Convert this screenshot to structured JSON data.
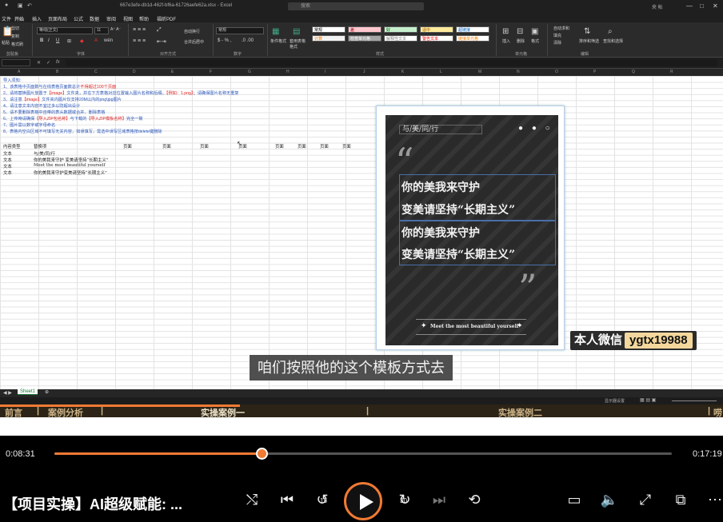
{
  "excel": {
    "filename": "667e3efe-db1d-462f-bf6a-61726aefe62a.xlsx  -  Excel",
    "search_placeholder": "搜索",
    "user": "夹 帐",
    "tabs": [
      "文件",
      "开始",
      "插入",
      "页面布局",
      "公式",
      "数据",
      "审阅",
      "视图",
      "帮助",
      "福昕PDF"
    ],
    "active_tab": "开始",
    "ribbon": {
      "clipboard_items": [
        "剪切",
        "复制",
        "格式刷"
      ],
      "paste": "粘贴",
      "font_name": "等线(正文)",
      "font_size": "11",
      "wrap": "自动换行",
      "merge": "合并后居中",
      "number_format": "常规",
      "conditional_format": "条件格式",
      "table_format": "套用表格格式",
      "styles": [
        {
          "label": "常规",
          "bg": "#ffffff",
          "fg": "#000000"
        },
        {
          "label": "差",
          "bg": "#ffc7ce",
          "fg": "#9c0006"
        },
        {
          "label": "好",
          "bg": "#c6efce",
          "fg": "#006100"
        },
        {
          "label": "适中",
          "bg": "#ffeb9c",
          "fg": "#9c5700"
        },
        {
          "label": "超链接",
          "bg": "#ffffff",
          "fg": "#0563c1"
        },
        {
          "label": "计算",
          "bg": "#f2f2f2",
          "fg": "#fa7d00"
        },
        {
          "label": "检查单元格",
          "bg": "#a5a5a5",
          "fg": "#ffffff"
        },
        {
          "label": "解释性文本",
          "bg": "#ffffff",
          "fg": "#7f7f7f"
        },
        {
          "label": "警告文本",
          "bg": "#ffffff",
          "fg": "#ff0000"
        },
        {
          "label": "链接单元格",
          "bg": "#ffffff",
          "fg": "#fa7d00"
        }
      ],
      "cells_items": [
        "插入",
        "删除",
        "格式"
      ],
      "editing_items": [
        "自动求和",
        "填充",
        "清除",
        "排序和筛选",
        "查找和选择"
      ],
      "groups": [
        "剪贴板",
        "字体",
        "对齐方式",
        "数字",
        "样式",
        "单元格",
        "编辑"
      ]
    },
    "name_box": "",
    "fx_label": "fx",
    "columns": [
      "A",
      "B",
      "C",
      "D",
      "E",
      "F",
      "G",
      "H",
      "I",
      "J",
      "K",
      "L",
      "M",
      "N",
      "O",
      "P",
      "Q",
      "R"
    ],
    "instructions_title": "导入须知:",
    "instructions": [
      "1、该表格中页面数与在线表格页面数总计不得超过100个页面",
      "2、请将替换图片放置于【image】文件夹，并在下方表格对应位置输入图片名称和后缀。【例如：1.png】；请确保图片名称无重复",
      "3、请注意【image】文件夹内图片仅支持20M以内的png\\jpg图片",
      "4、请注意文本内容不宜过多以防超出设计",
      "5、请不要删除表格中自带的表头数据或合并、删除表格",
      "6、上传時请确保【导入ZIP包名称】与下载的【导入ZIP模板名称】完全一致",
      "7、图片需以数字或字母命名",
      "8、表格内空白区域不可填写无关内容，如误填写，需选中误写区域表格按delete键删除"
    ],
    "table_header": [
      "内容类型",
      "替换项",
      "页面",
      "页面",
      "页面",
      "页面",
      "页面",
      "页面",
      "页面",
      "页面"
    ],
    "rows": [
      [
        "文本",
        "与/美/同/行"
      ],
      [
        "文本",
        "你的美我来守护 变美请坚持“长期主义”"
      ],
      [
        "文本",
        "Meet the most beautiful yourself"
      ],
      [
        "文本",
        "你的美我来守护变美请坚持“长期主义”"
      ]
    ],
    "sheet_tab": "Sheet1",
    "status_right": "显示器设置"
  },
  "poster": {
    "top_text": "与/美/同/行",
    "line1": "你的美我来守护",
    "line2": "变美请坚持“长期主义”",
    "line3": "你的美我来守护",
    "line4": "变美请坚持“长期主义”",
    "bottom_text": "Meet the most beautiful yourself",
    "quote_open": "“",
    "quote_close": "”",
    "dots": "● ● ○"
  },
  "overlay": {
    "wechat_label": "本人微信",
    "wechat_id": "ygtx19988",
    "subtitle": "咱们按照他的这个模板方式去"
  },
  "chapters": [
    "前言",
    "|",
    "案例分析",
    "|",
    "实操案例一",
    "|",
    "实操案例二",
    "|",
    "唠"
  ],
  "player": {
    "current_time": "0:08:31",
    "total_time": "0:17:19",
    "progress": 0.336,
    "video_title": "【项目实操】AI超级赋能: ...",
    "skip_back_seconds": "15",
    "skip_forward_seconds": "30",
    "accent": "#f07a34"
  }
}
